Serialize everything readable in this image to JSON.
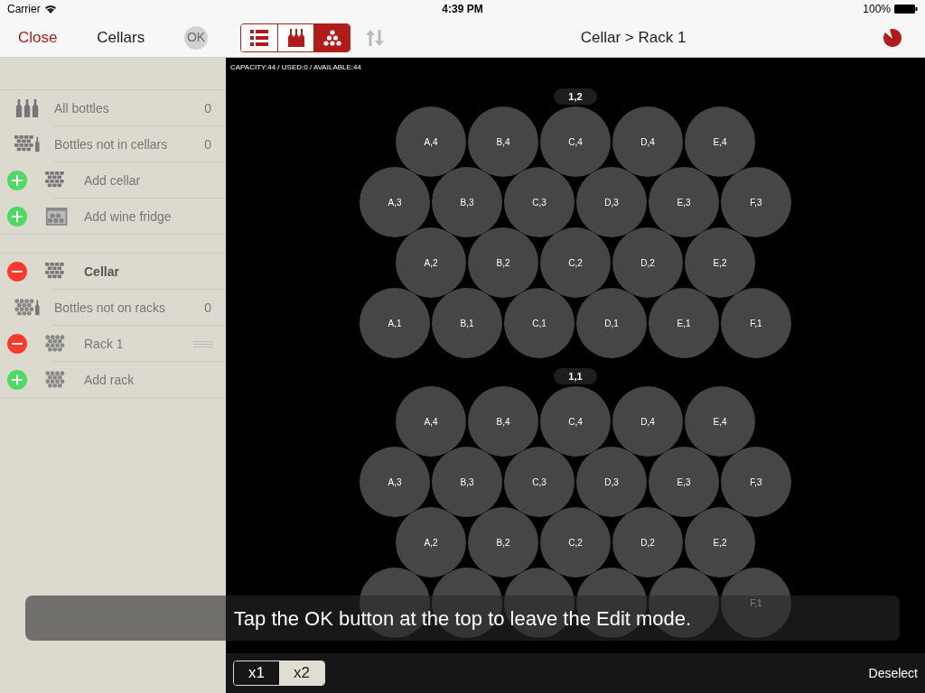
{
  "status_bar": {
    "carrier": "Carrier",
    "time": "4:39 PM",
    "battery": "100%"
  },
  "nav": {
    "close": "Close",
    "title_left": "Cellars",
    "ok": {
      "label": "OK",
      "disabled": true
    },
    "views": [
      {
        "selected": false
      },
      {
        "selected": false
      },
      {
        "selected": true
      }
    ],
    "title": "Cellar > Rack 1"
  },
  "sidebar": {
    "groups": [
      {
        "items": [
          {
            "kind": "item",
            "label": "All bottles",
            "count": "0",
            "heading": false,
            "reorderable": false
          },
          {
            "kind": "item",
            "label": "Bottles not in cellars",
            "count": "0",
            "heading": false,
            "reorderable": false
          },
          {
            "kind": "add",
            "label": "Add cellar",
            "heading": false,
            "reorderable": false
          },
          {
            "kind": "add",
            "label": "Add wine fridge",
            "heading": false,
            "reorderable": false
          }
        ]
      },
      {
        "items": [
          {
            "kind": "remove",
            "label": "Cellar",
            "heading": true,
            "reorderable": false
          },
          {
            "kind": "item",
            "label": "Bottles not on racks",
            "count": "0",
            "heading": false,
            "reorderable": false
          },
          {
            "kind": "remove",
            "label": "Rack 1",
            "heading": false,
            "reorderable": true
          },
          {
            "kind": "add",
            "label": "Add rack",
            "heading": false,
            "reorderable": false
          }
        ]
      }
    ]
  },
  "capacity": "CAPACITY:44 / USED:0 / AVAILABLE:44",
  "racks": [
    {
      "label": "1,2",
      "rows": [
        {
          "cells": [
            {
              "label": "A,4"
            },
            {
              "label": "B,4"
            },
            {
              "label": "C,4"
            },
            {
              "label": "D,4"
            },
            {
              "label": "E,4"
            }
          ]
        },
        {
          "cells": [
            {
              "label": "A,3"
            },
            {
              "label": "B,3"
            },
            {
              "label": "C,3"
            },
            {
              "label": "D,3"
            },
            {
              "label": "E,3"
            },
            {
              "label": "F,3"
            }
          ]
        },
        {
          "cells": [
            {
              "label": "A,2"
            },
            {
              "label": "B,2"
            },
            {
              "label": "C,2"
            },
            {
              "label": "D,2"
            },
            {
              "label": "E,2"
            }
          ]
        },
        {
          "cells": [
            {
              "label": "A,1"
            },
            {
              "label": "B,1"
            },
            {
              "label": "C,1"
            },
            {
              "label": "D,1"
            },
            {
              "label": "E,1"
            },
            {
              "label": "F,1"
            }
          ]
        }
      ]
    },
    {
      "label": "1,1",
      "rows": [
        {
          "cells": [
            {
              "label": "A,4"
            },
            {
              "label": "B,4"
            },
            {
              "label": "C,4"
            },
            {
              "label": "D,4"
            },
            {
              "label": "E,4"
            }
          ]
        },
        {
          "cells": [
            {
              "label": "A,3"
            },
            {
              "label": "B,3"
            },
            {
              "label": "C,3"
            },
            {
              "label": "D,3"
            },
            {
              "label": "E,3"
            },
            {
              "label": "F,3"
            }
          ]
        },
        {
          "cells": [
            {
              "label": "A,2"
            },
            {
              "label": "B,2"
            },
            {
              "label": "C,2"
            },
            {
              "label": "D,2"
            },
            {
              "label": "E,2"
            }
          ]
        },
        {
          "cells": [
            {},
            {},
            {},
            {},
            {},
            {
              "label": "F,1"
            }
          ]
        }
      ]
    }
  ],
  "zoom": [
    {
      "label": "x1",
      "selected": false
    },
    {
      "label": "x2",
      "selected": true
    }
  ],
  "deselect": "Deselect",
  "toast": "Tap the OK button at the top to leave the Edit mode."
}
